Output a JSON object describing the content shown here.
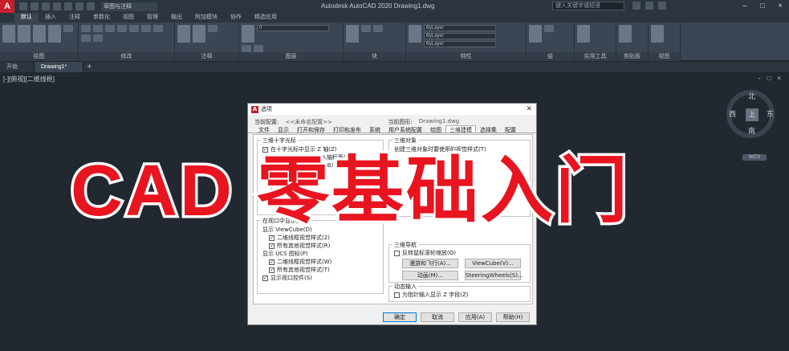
{
  "app": {
    "logo": "A",
    "title": "Autodesk AutoCAD 2020    Drawing1.dwg",
    "workspace": "草图与注释",
    "search_placeholder": "键入关键字或短语"
  },
  "ribbon": {
    "tabs": [
      "默认",
      "插入",
      "注释",
      "参数化",
      "视图",
      "管理",
      "输出",
      "附加模块",
      "协作",
      "精选应用"
    ],
    "panels": [
      {
        "label": "绘图"
      },
      {
        "label": "修改"
      },
      {
        "label": "注释"
      },
      {
        "label": "图层"
      },
      {
        "label": "块"
      },
      {
        "label": "特性"
      },
      {
        "label": "组"
      },
      {
        "label": "实用工具"
      },
      {
        "label": "剪贴板"
      },
      {
        "label": "视图"
      }
    ],
    "layer_combo": "0",
    "prop_combos": [
      "ByLayer",
      "ByLayer",
      "ByLayer"
    ]
  },
  "filetabs": {
    "items": [
      "开始",
      "Drawing1*"
    ],
    "active": 1
  },
  "viewport": {
    "label": "[-][俯视][二维线框]",
    "controls": [
      "-",
      "□",
      "×"
    ]
  },
  "viewcube": {
    "north": "北",
    "south": "南",
    "east": "东",
    "west": "西",
    "face": "上",
    "wcs": "WCS"
  },
  "dialog": {
    "title": "选项",
    "profile_label": "当前配置:",
    "profile_value": "<<未命名配置>>",
    "drawing_label": "当前图形:",
    "drawing_value": "Drawing1.dwg",
    "tabs": [
      "文件",
      "显示",
      "打开和保存",
      "打印和发布",
      "系统",
      "用户系统配置",
      "绘图",
      "三维建模",
      "选择集",
      "配置"
    ],
    "active_tab": 7,
    "crosshair": {
      "title": "三维十字光标",
      "opt1": "在十字光标中显示 Z 轴(Z)",
      "opt2": "在标准十字光标中加入轴标签(L)",
      "opt3": "对动态 UCS 显示标签(B)",
      "sub": "十字光标标签",
      "r1": "使用 X、Y、Z",
      "r2": "使用 N、E、z",
      "r3": "使用自定义标签"
    },
    "viewport_grp": {
      "title": "在视口中显示工具",
      "viewcube_label": "显示 ViewCube(D)",
      "vc1": "二维线框视觉样式(2)",
      "vc2": "所有其他视觉样式(R)",
      "ucs_label": "显示 UCS 图标(P)",
      "u1": "二维线框视觉样式(W)",
      "u2": "所有其他视觉样式(T)",
      "vp_ctrl": "显示视口控件(S)"
    },
    "objects3d": {
      "title": "三维对象",
      "visual_style_label": "创建三维对象时要使用的视觉样式(T)"
    },
    "nav3d": {
      "title": "三维导航",
      "reverse": "反转鼠标滚轮缩放(O)",
      "walk": "漫游和飞行(A)...",
      "viewcube": "ViewCube(V)...",
      "anim": "动画(M)...",
      "steering": "SteeringWheels(S)..."
    },
    "dyn": {
      "title": "动态输入",
      "opt": "为指针输入显示 Z 字段(Z)"
    },
    "buttons": {
      "ok": "确定",
      "cancel": "取消",
      "apply": "应用(A)",
      "help": "帮助(H)"
    }
  },
  "overlay": {
    "text": "CAD 零基础入门",
    "color": "#e8141f"
  }
}
